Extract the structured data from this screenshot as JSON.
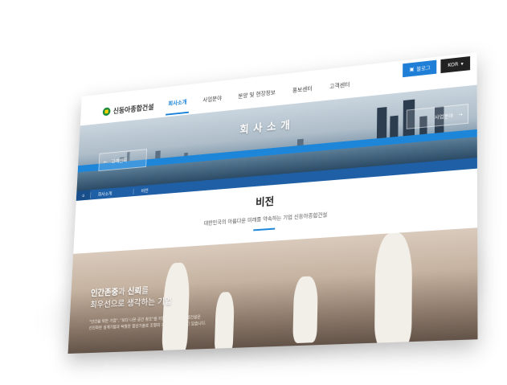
{
  "header": {
    "logo_text": "신동아종합건설",
    "nav": [
      "회사소개",
      "사업분야",
      "분양 및 현장정보",
      "홍보센터",
      "고객센터"
    ],
    "blog_button": "블로그",
    "lang_button": "KOR"
  },
  "hero": {
    "title": "회사소개",
    "prev_label": "고객센터",
    "next_label": "사업분야"
  },
  "breadcrumb": {
    "items": [
      "회사소개",
      "비전"
    ]
  },
  "vision": {
    "title": "비전",
    "subtitle": "대한민국의 아름다운 미래를 약속하는 기업 신동아종합건설"
  },
  "photo": {
    "headline_part1": "인간존중",
    "headline_part2": "과 ",
    "headline_part3": "신뢰",
    "headline_part4": "를",
    "headline_line2": "최우선으로 생각하는 기업",
    "body_line1": "\"인간을 위한 기업\", \"보다 나은 공간 창조\"를 지향하는 신동아종합건설은",
    "body_line2": "선진화된 설계기법과 탁월한 첨단기술로 조형미 기업으로 도약하고 있습니다."
  },
  "colors": {
    "accent_blue": "#1e86d8",
    "breadcrumb_blue": "#1e5fa6",
    "logo_green": "#1a8c3c"
  }
}
